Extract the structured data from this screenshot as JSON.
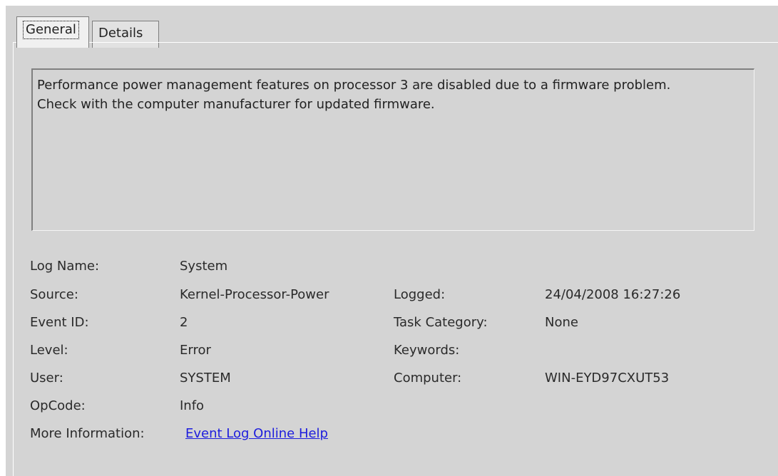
{
  "tabs": {
    "general": "General",
    "details": "Details"
  },
  "message": "Performance power management features on processor 3 are disabled due to a firmware problem.\nCheck with the computer manufacturer for updated firmware.",
  "fields": {
    "log_name": {
      "label": "Log Name:",
      "value": "System"
    },
    "source": {
      "label": "Source:",
      "value": "Kernel-Processor-Power"
    },
    "event_id": {
      "label": "Event ID:",
      "value": "2"
    },
    "level": {
      "label": "Level:",
      "value": "Error"
    },
    "user": {
      "label": "User:",
      "value": "SYSTEM"
    },
    "opcode": {
      "label": "OpCode:",
      "value": "Info"
    },
    "more_information": {
      "label": "More Information:",
      "value": "Event Log Online Help"
    },
    "logged": {
      "label": "Logged:",
      "value": "24/04/2008 16:27:26"
    },
    "task_category": {
      "label": "Task Category:",
      "value": "None"
    },
    "keywords": {
      "label": "Keywords:",
      "value": ""
    },
    "computer": {
      "label": "Computer:",
      "value": "WIN-EYD97CXUT53"
    }
  },
  "colors": {
    "window_background": "#d4d4d4",
    "link": "#1d1ddd"
  }
}
